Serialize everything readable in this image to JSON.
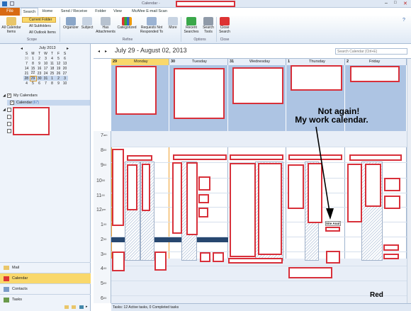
{
  "window": {
    "title": "Calendar -"
  },
  "tabs": [
    {
      "label": "File"
    },
    {
      "label": "Search"
    },
    {
      "label": "Home"
    },
    {
      "label": "Send / Receive"
    },
    {
      "label": "Folder"
    },
    {
      "label": "View"
    },
    {
      "label": "McAfee E-mail Scan"
    }
  ],
  "ribbon": {
    "all_calendar": "All Calendar Items",
    "current_folder": "Current Folder",
    "all_subfolders": "All Subfolders",
    "all_outlook": "All Outlook Items",
    "organizer": "Organizer",
    "subject": "Subject",
    "has_attachments": "Has Attachments",
    "categorized": "Categorized",
    "requests": "Requests Not Responded To",
    "more": "More",
    "recent_searches": "Recent Searches",
    "search_tools": "Search Tools",
    "close_search": "Close Search",
    "groups": {
      "scope": "Scope",
      "refine": "Refine",
      "options": "Options",
      "close": "Close"
    }
  },
  "mini_calendar": {
    "month": "July 2013",
    "weekdays": [
      "S",
      "M",
      "T",
      "W",
      "T",
      "F",
      "S"
    ],
    "weeks": [
      [
        "30",
        "1",
        "2",
        "3",
        "4",
        "5",
        "6"
      ],
      [
        "7",
        "8",
        "9",
        "10",
        "11",
        "12",
        "13"
      ],
      [
        "14",
        "15",
        "16",
        "17",
        "18",
        "19",
        "20"
      ],
      [
        "21",
        "22",
        "23",
        "24",
        "25",
        "26",
        "27"
      ],
      [
        "28",
        "29",
        "30",
        "31",
        "1",
        "2",
        "3"
      ],
      [
        "4",
        "5",
        "6",
        "7",
        "8",
        "9",
        "10"
      ]
    ]
  },
  "nav": {
    "my_calendars": "My Calendars",
    "calendar": "Calendar",
    "calendar_count": "(67)"
  },
  "bottom_nav": {
    "mail": "Mail",
    "calendar": "Calendar",
    "contacts": "Contacts",
    "tasks": "Tasks"
  },
  "cal": {
    "range": "July 29 - August 02, 2013",
    "search_placeholder": "Search Calendar (Ctrl+E)",
    "days": [
      {
        "num": "29",
        "name": "Monday"
      },
      {
        "num": "30",
        "name": "Tuesday"
      },
      {
        "num": "31",
        "name": "Wednesday"
      },
      {
        "num": "1",
        "name": "Thursday"
      },
      {
        "num": "2",
        "name": "Friday"
      }
    ],
    "hours": [
      "7",
      "8",
      "9",
      "10",
      "11",
      "12",
      "1",
      "2",
      "3",
      "4",
      "5",
      "6"
    ],
    "hour_sup": [
      "am",
      "00",
      "00",
      "00",
      "00",
      "pm",
      "00",
      "00",
      "00",
      "00",
      "00",
      "00"
    ],
    "site_anal": "Site Anal",
    "status": "Tasks: 12 Active tasks, 0 Completed tasks"
  },
  "annotation": {
    "line1": "Not again!",
    "line2": "My work calendar.",
    "red": "Red"
  }
}
